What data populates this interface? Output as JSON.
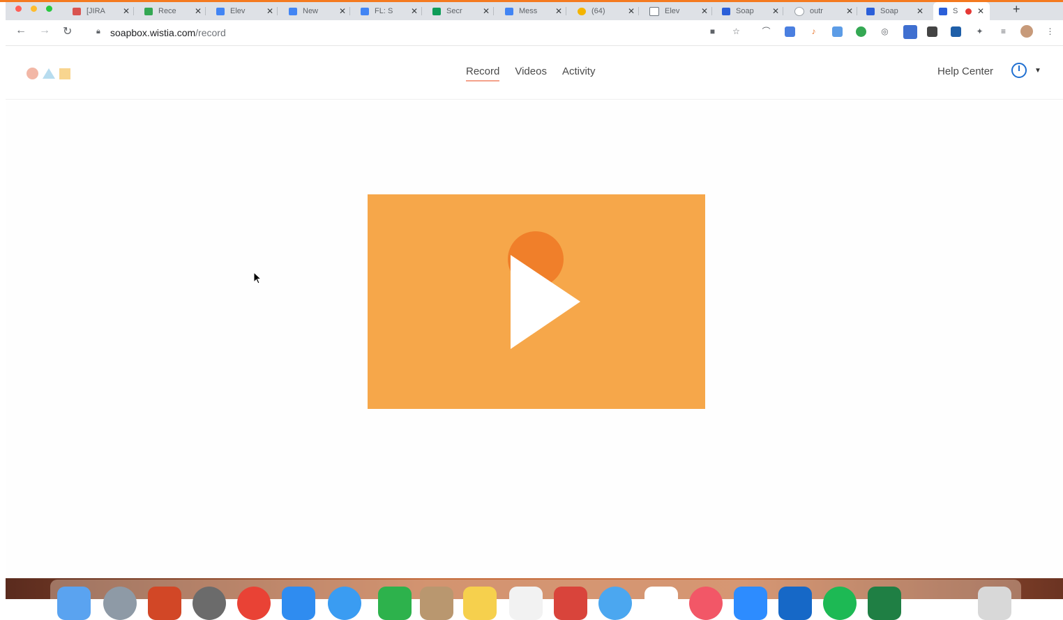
{
  "browser": {
    "tabs": [
      {
        "title": "[JIRA",
        "color": "#d9534f"
      },
      {
        "title": "Rece",
        "color": "#34a853"
      },
      {
        "title": "Elev",
        "color": "#4285f4"
      },
      {
        "title": "New",
        "color": "#4285f4"
      },
      {
        "title": "FL: S",
        "color": "#4285f4"
      },
      {
        "title": "Secr",
        "color": "#0f9d58"
      },
      {
        "title": "Mess",
        "color": "#4285f4"
      },
      {
        "title": "(64)",
        "color": "#f4b400"
      },
      {
        "title": "Elev",
        "color": "#6c757d"
      },
      {
        "title": "Soap",
        "color": "#2b5fd9"
      },
      {
        "title": "outr",
        "color": "#9aa0a6"
      },
      {
        "title": "Soap",
        "color": "#2b5fd9"
      },
      {
        "title": "S",
        "color": "#2b5fd9",
        "active": true
      }
    ],
    "new_tab_label": "+",
    "url_host": "soapbox.wistia.com",
    "url_path": "/record",
    "nav_icons": [
      "back-icon",
      "forward-icon",
      "reload-icon"
    ]
  },
  "site": {
    "nav": [
      {
        "label": "Record",
        "active": true
      },
      {
        "label": "Videos",
        "active": false
      },
      {
        "label": "Activity",
        "active": false
      }
    ],
    "help_label": "Help Center",
    "accent": "#f4a28b",
    "video_bg": "#f6a74a",
    "video_circle": "#f07f2a",
    "power_color": "#1f6fd1"
  }
}
